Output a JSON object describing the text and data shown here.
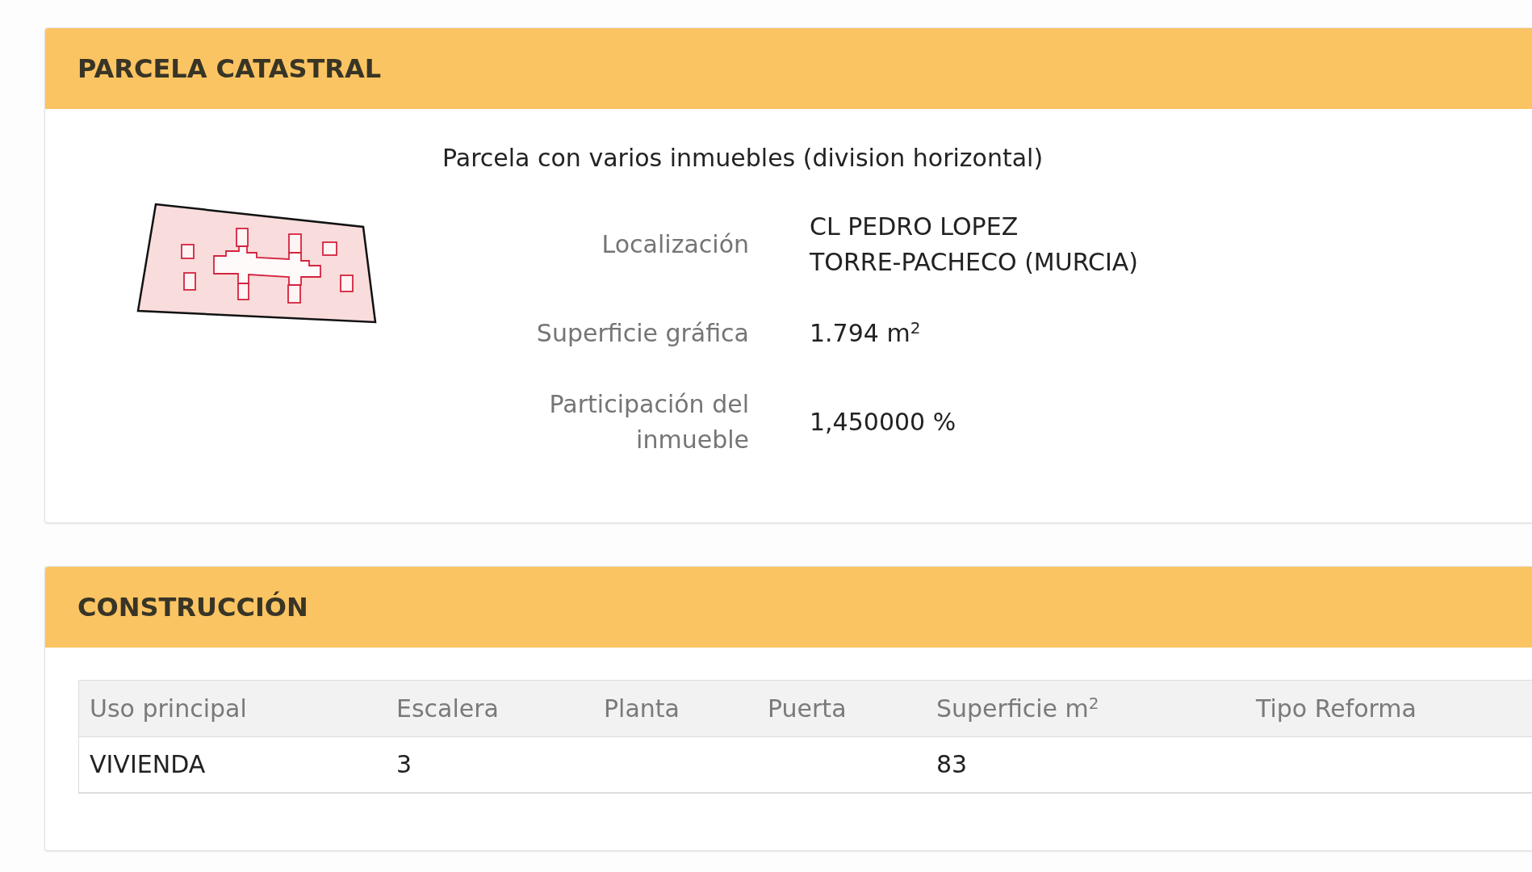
{
  "parcel_section": {
    "title": "PARCELA CATASTRAL",
    "description": "Parcela con varios inmuebles (division horizontal)",
    "fields": [
      {
        "label": "Localización",
        "value_lines": [
          "CL PEDRO LOPEZ",
          "TORRE-PACHECO (MURCIA)"
        ]
      },
      {
        "label": "Superficie gráfica",
        "value_lines": [
          "1.794 m$^{2}$"
        ]
      },
      {
        "label": "Participación del inmueble",
        "value_lines": [
          "1,450000 %"
        ]
      }
    ]
  },
  "construction_section": {
    "title": "CONSTRUCCIÓN",
    "table": {
      "columns": [
        "Uso principal",
        "Escalera",
        "Planta",
        "Puerta",
        "Superficie m$^{2}$",
        "Tipo Reforma"
      ],
      "rows": [
        {
          "cells": [
            "VIVIENDA",
            "3",
            null,
            null,
            "83",
            null
          ]
        }
      ]
    }
  }
}
